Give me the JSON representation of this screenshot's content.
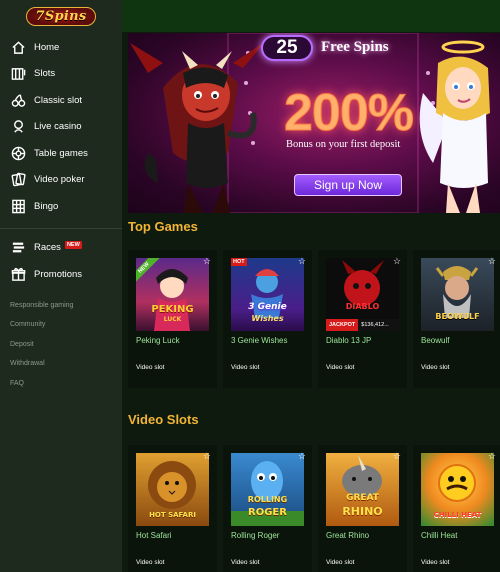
{
  "logo": {
    "text": "7Spins"
  },
  "nav": {
    "items": [
      {
        "label": "Home",
        "icon": "home-icon"
      },
      {
        "label": "Slots",
        "icon": "slots-icon"
      },
      {
        "label": "Classic slot",
        "icon": "cherries-icon"
      },
      {
        "label": "Live casino",
        "icon": "dealer-icon"
      },
      {
        "label": "Table games",
        "icon": "roulette-icon"
      },
      {
        "label": "Video poker",
        "icon": "cards-icon"
      },
      {
        "label": "Bingo",
        "icon": "bingo-card-icon"
      }
    ],
    "races": {
      "label": "Races",
      "badge": "NEW"
    },
    "promotions": {
      "label": "Promotions"
    },
    "sub_links": [
      "Responsible gaming",
      "Community",
      "Deposit",
      "Withdrawal",
      "FAQ"
    ]
  },
  "banner": {
    "spins_count": "25",
    "spins_label": "Free Spins",
    "percent": "200%",
    "bonus_text": "Bonus on your first deposit",
    "cta": "Sign up Now"
  },
  "sections": [
    {
      "title": "Top Games",
      "games": [
        {
          "title": "Peking Luck",
          "type": "Video slot",
          "thumb_text": "PEKING",
          "thumb_sub": "LUCK",
          "badge": "NEW"
        },
        {
          "title": "3 Genie Wishes",
          "type": "Video slot",
          "thumb_text": "3 Genie",
          "thumb_sub": "Wishes",
          "badge": "HOT"
        },
        {
          "title": "Diablo 13 JP",
          "type": "Video slot",
          "thumb_text": "DIABLO",
          "jackpot_label": "JACKPOT",
          "jackpot_value": "$136,412..."
        },
        {
          "title": "Beowulf",
          "type": "Video slot",
          "thumb_text": "BEOWULF"
        }
      ]
    },
    {
      "title": "Video Slots",
      "games": [
        {
          "title": "Hot Safari",
          "type": "Video slot",
          "thumb_text": "HOT SAFARI"
        },
        {
          "title": "Rolling Roger",
          "type": "Video slot",
          "thumb_text": "ROLLING",
          "thumb_sub": "ROGER"
        },
        {
          "title": "Great Rhino",
          "type": "Video slot",
          "thumb_text": "GREAT",
          "thumb_sub": "RHINO"
        },
        {
          "title": "Chilli Heat",
          "type": "Video slot",
          "thumb_text": "CHILLI HEAT"
        }
      ]
    }
  ],
  "colors": {
    "sidebar_bg": "#1e2a1e",
    "topbar_bg": "#0e3510",
    "page_bg": "#0d1a0d",
    "section_title": "#f2b437",
    "game_title": "#9ee69b",
    "badge_red": "#d61b1b",
    "cta_purple": "#7c3aed"
  }
}
